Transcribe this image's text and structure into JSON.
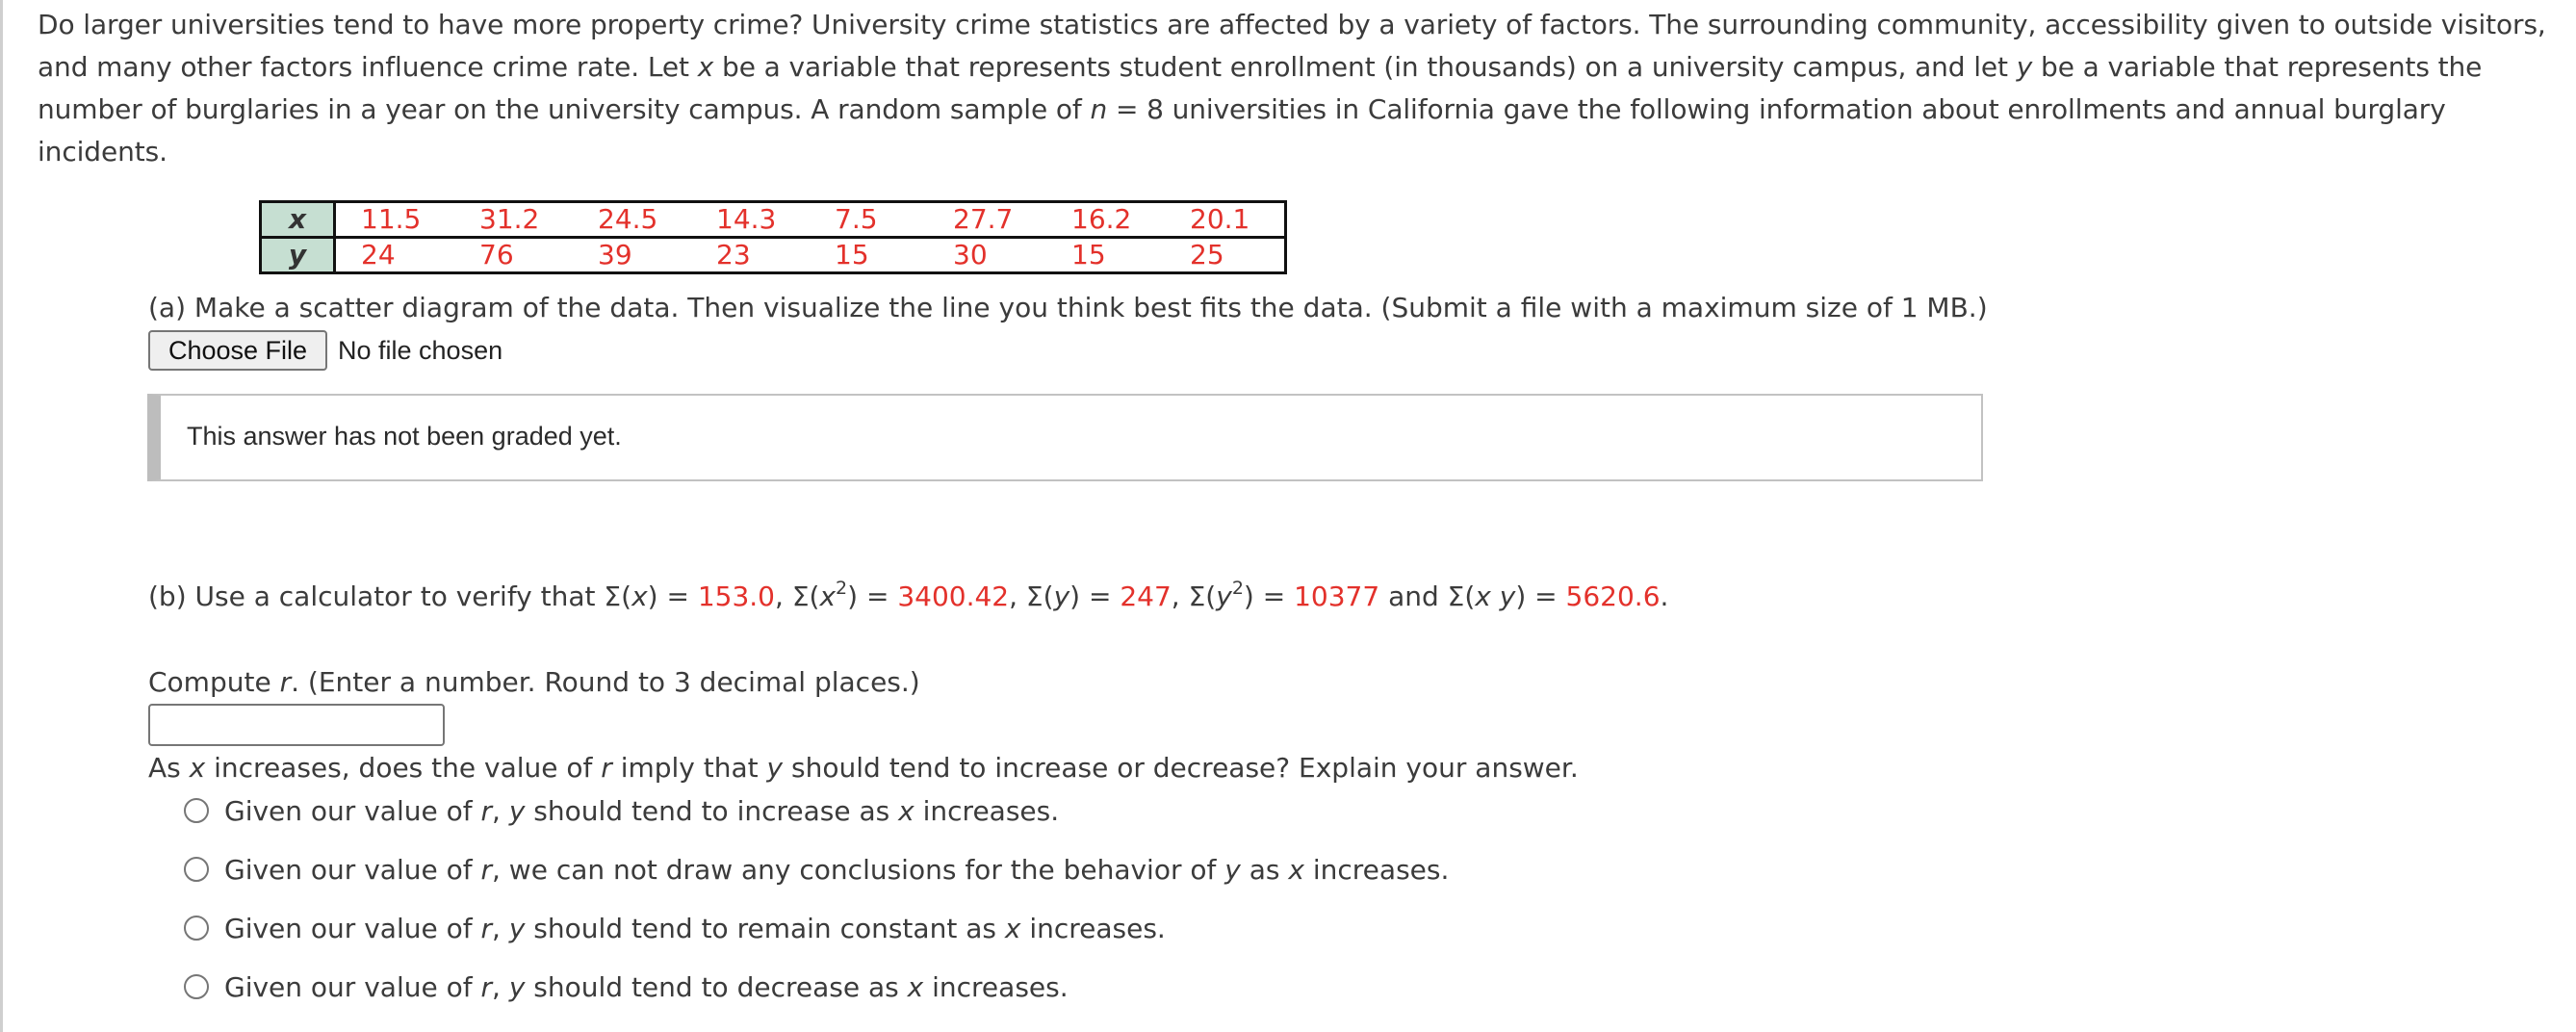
{
  "intro": {
    "t1": "Do larger universities tend to have more property crime? University crime statistics are affected by a variety of factors. The surrounding community, accessibility given to outside visitors, and many other factors influence crime rate. Let ",
    "var_x": "x",
    "t2": " be a variable that represents student enrollment (in thousands) on a university campus, and let ",
    "var_y": "y",
    "t3": " be a variable that represents the number of burglaries in a year on the university campus. A random sample of ",
    "var_n": "n",
    "t4": " = 8 universities in California gave the following information about enrollments and annual burglary incidents."
  },
  "table": {
    "x_label": "x",
    "y_label": "y",
    "x_values": [
      "11.5",
      "31.2",
      "24.5",
      "14.3",
      "7.5",
      "27.7",
      "16.2",
      "20.1"
    ],
    "y_values": [
      "24",
      "76",
      "39",
      "23",
      "15",
      "30",
      "15",
      "25"
    ]
  },
  "part_a": {
    "prompt": "(a) Make a scatter diagram of the data. Then visualize the line you think best fits the data. (Submit a file with a maximum size of 1 MB.)",
    "choose_file_label": "Choose File",
    "file_status": "No file chosen",
    "graded_message": "This answer has not been graded yet."
  },
  "part_b": {
    "lead": "(b) Use a calculator to verify that ",
    "sigma": "Σ",
    "sum_x_expr_open": "(",
    "sum_x_var": "x",
    "sum_x_expr_close": ") = ",
    "sum_x": "153.0",
    "sep1": ", ",
    "sum_x2_var": "x",
    "sum_x2_exp": "2",
    "sum_x2_close": ") = ",
    "sum_x2": "3400.42",
    "sep2": ", ",
    "sum_y_var": "y",
    "sum_y_close": ") = ",
    "sum_y": "247",
    "sep3": ", ",
    "sum_y2_var": "y",
    "sum_y2_exp": "2",
    "sum_y2_close": ") = ",
    "sum_y2": "10377",
    "and": " and ",
    "sum_xy_var": "x y",
    "sum_xy_close": ") = ",
    "sum_xy": "5620.6",
    "end": ".",
    "compute_pre": "Compute ",
    "compute_var": "r",
    "compute_post": ". (Enter a number. Round to 3 decimal places.)",
    "r_input_value": "",
    "question": {
      "p1": "As ",
      "v1": "x",
      "p2": " increases, does the value of ",
      "v2": "r",
      "p3": " imply that ",
      "v3": "y",
      "p4": " should tend to increase or decrease? Explain your answer."
    },
    "options": [
      {
        "a": "Given our value of ",
        "r": "r",
        "b": ", ",
        "y": "y",
        "c": " should tend to increase as ",
        "x": "x",
        "d": " increases."
      },
      {
        "a": "Given our value of ",
        "r": "r",
        "b": ", we can not draw any conclusions for the behavior of ",
        "y": "y",
        "c": " as ",
        "x": "x",
        "d": " increases."
      },
      {
        "a": "Given our value of ",
        "r": "r",
        "b": ", ",
        "y": "y",
        "c": " should tend to remain constant as ",
        "x": "x",
        "d": " increases."
      },
      {
        "a": "Given our value of ",
        "r": "r",
        "b": ", ",
        "y": "y",
        "c": " should tend to decrease as ",
        "x": "x",
        "d": " increases."
      }
    ]
  },
  "colors": {
    "answer_red": "#e3312b",
    "text": "#3b3b3b",
    "table_header_bg": "#c6dfd2"
  }
}
